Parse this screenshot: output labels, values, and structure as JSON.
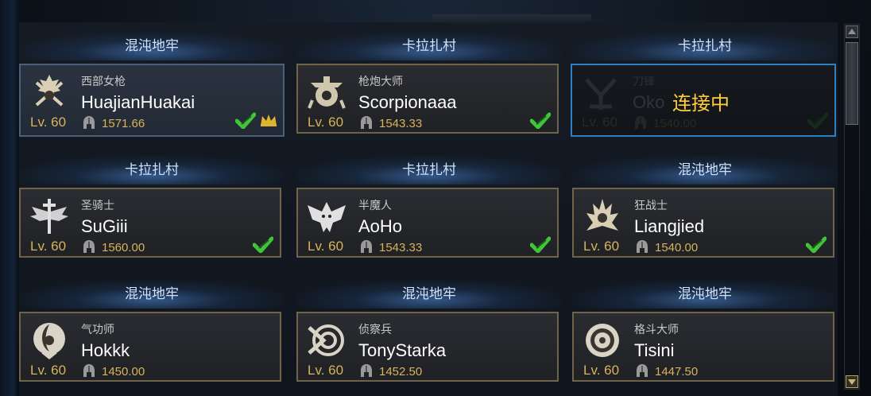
{
  "status": {
    "connecting_label": "连接中"
  },
  "colors": {
    "gold": "#d8b35a",
    "ready_green": "#3fc43a",
    "connecting_yellow": "#ffcf3a",
    "frame_gold": "#6f644a",
    "frame_blue": "#2f7fc0"
  },
  "slots": [
    {
      "room": "混沌地牢",
      "class": "西部女枪",
      "name": "HuajianHuakai",
      "level": "Lv. 60",
      "rating": "1571.66",
      "ready": true,
      "host": true,
      "emblem": "crossed-guns-emblem-icon"
    },
    {
      "room": "卡拉扎村",
      "class": "枪炮大师",
      "name": "Scorpionaaa",
      "level": "Lv. 60",
      "rating": "1543.33",
      "ready": true,
      "host": false,
      "emblem": "cannon-gear-emblem-icon"
    },
    {
      "room": "卡拉扎村",
      "class": "刀锋",
      "name": "Oko",
      "level": "Lv. 60",
      "rating": "1540.00",
      "ready": true,
      "host": false,
      "connecting": true,
      "emblem": "blade-emblem-icon"
    },
    {
      "room": "卡拉扎村",
      "class": "圣骑士",
      "name": "SuGiii",
      "level": "Lv. 60",
      "rating": "1560.00",
      "ready": true,
      "host": false,
      "emblem": "winged-sword-emblem-icon"
    },
    {
      "room": "卡拉扎村",
      "class": "半魔人",
      "name": "AoHo",
      "level": "Lv. 60",
      "rating": "1543.33",
      "ready": true,
      "host": false,
      "emblem": "demon-wings-emblem-icon"
    },
    {
      "room": "混沌地牢",
      "class": "狂战士",
      "name": "Liangjied",
      "level": "Lv. 60",
      "rating": "1540.00",
      "ready": true,
      "host": false,
      "emblem": "berserker-crest-emblem-icon"
    },
    {
      "room": "混沌地牢",
      "class": "气功师",
      "name": "Hokkk",
      "level": "Lv. 60",
      "rating": "1450.00",
      "ready": false,
      "host": false,
      "emblem": "qi-orb-emblem-icon"
    },
    {
      "room": "混沌地牢",
      "class": "侦察兵",
      "name": "TonyStarka",
      "level": "Lv. 60",
      "rating": "1452.50",
      "ready": false,
      "host": false,
      "emblem": "scout-target-emblem-icon"
    },
    {
      "room": "混沌地牢",
      "class": "格斗大师",
      "name": "Tisini",
      "level": "Lv. 60",
      "rating": "1447.50",
      "ready": false,
      "host": false,
      "emblem": "fist-medallion-emblem-icon"
    }
  ]
}
